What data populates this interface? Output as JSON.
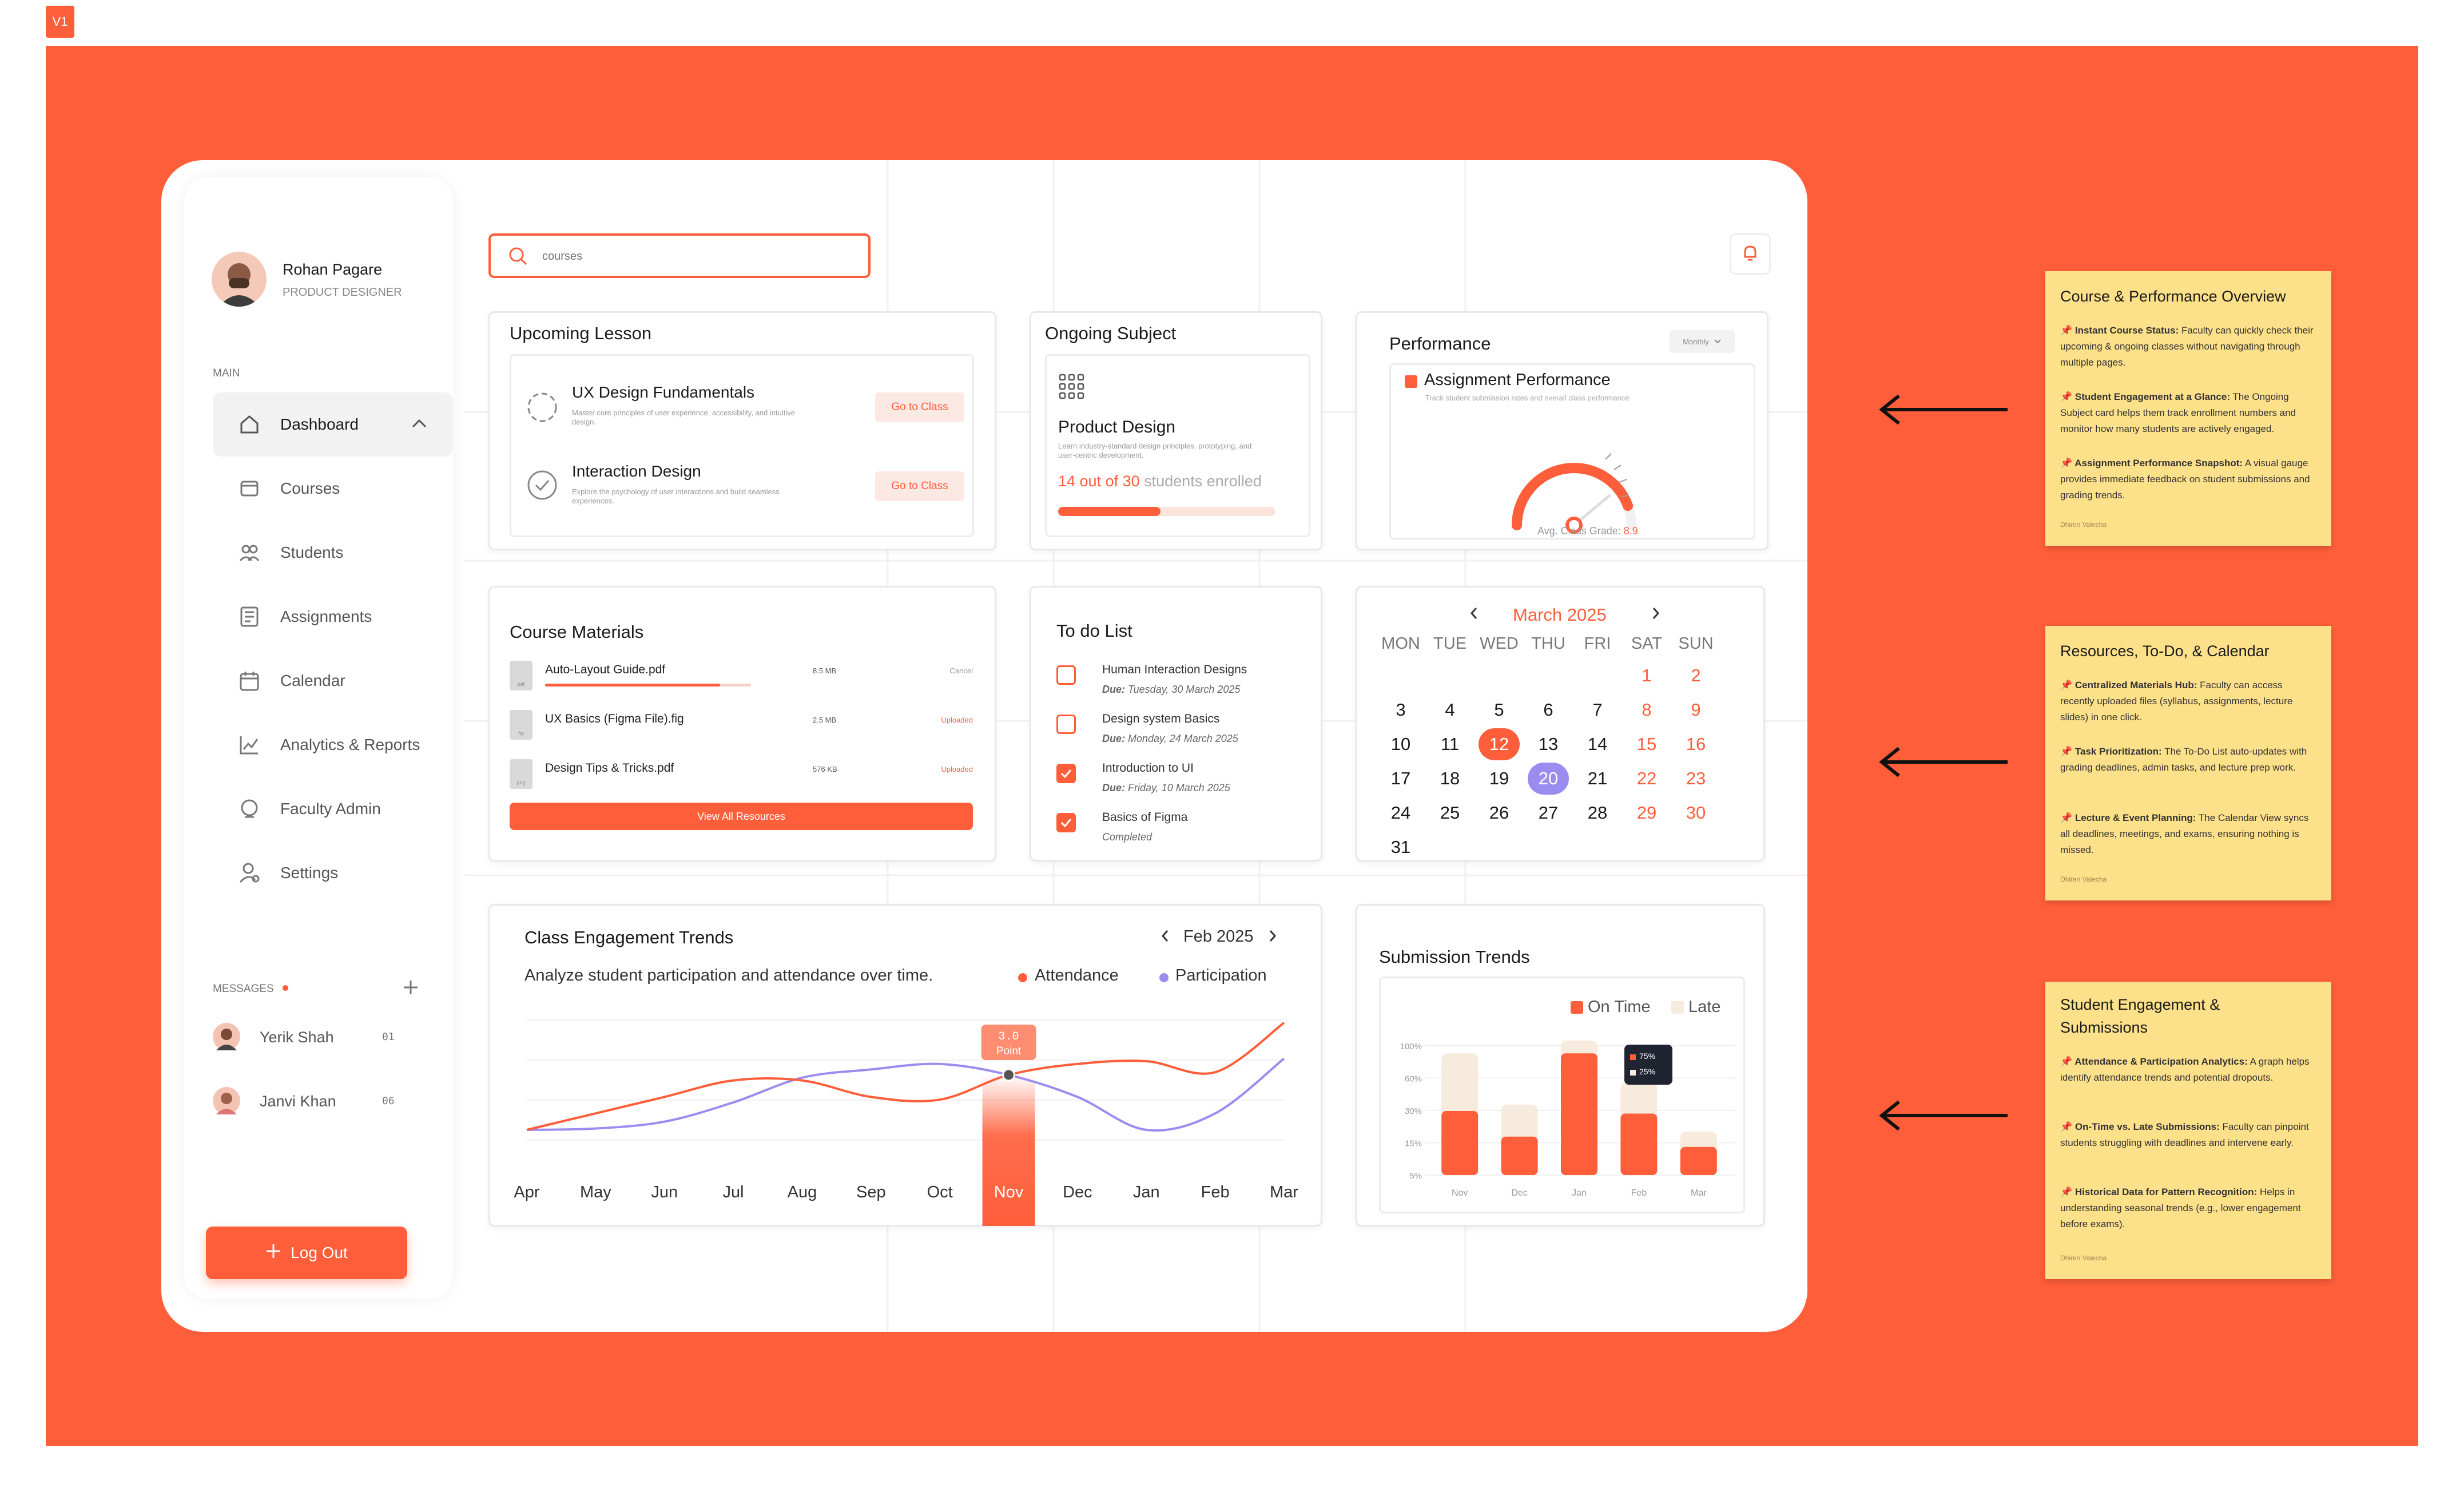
{
  "badge": "V1",
  "colors": {
    "accent": "#ff5e3a",
    "purple": "#9b8cf0",
    "note": "#fde08a",
    "late": "#f7ebdd"
  },
  "profile": {
    "name": "Rohan Pagare",
    "role": "PRODUCT DESIGNER"
  },
  "sidebar": {
    "section_main": "MAIN",
    "items": [
      {
        "label": "Dashboard",
        "icon": "dashboard-icon"
      },
      {
        "label": "Courses",
        "icon": "courses-icon"
      },
      {
        "label": "Students",
        "icon": "students-icon"
      },
      {
        "label": "Assignments",
        "icon": "assignments-icon"
      },
      {
        "label": "Calendar",
        "icon": "calendar-icon"
      },
      {
        "label": "Analytics & Reports",
        "icon": "analytics-icon"
      },
      {
        "label": "Faculty Admin",
        "icon": "faculty-icon"
      },
      {
        "label": "Settings",
        "icon": "settings-icon"
      }
    ],
    "messages_label": "MESSAGES",
    "messages": [
      {
        "name": "Yerik Shah",
        "count": "01"
      },
      {
        "name": "Janvi Khan",
        "count": "06"
      }
    ],
    "logout": "Log Out"
  },
  "search": {
    "placeholder": "courses"
  },
  "upcoming": {
    "title": "Upcoming Lesson",
    "lessons": [
      {
        "title": "UX Design Fundamentals",
        "desc": "Master core principles of user experience, accessibility, and intuitive design.",
        "button": "Go to Class"
      },
      {
        "title": "Interaction Design",
        "desc": "Explore the psychology of user interactions and build seamless experiences.",
        "button": "Go to Class"
      }
    ]
  },
  "ongoing": {
    "title": "Ongoing Subject",
    "subject": "Product Design",
    "desc": "Learn industry-standard design principles, prototyping, and user-centric development.",
    "enrolled_highlight": "14 out of 30",
    "enrolled_rest": " students enrolled",
    "progress": 0.47
  },
  "performance": {
    "title": "Performance",
    "dropdown": "Monthly",
    "subtitle": "Assignment Performance",
    "desc": "Track student submission rates and overall class performance",
    "grade_label": "Avg. Class Grade: ",
    "grade_value": "8.9",
    "gauge_fraction": 0.89
  },
  "materials": {
    "title": "Course Materials",
    "files": [
      {
        "name": "Auto-Layout Guide.pdf",
        "ext": "pdf",
        "size": "8.5 MB",
        "status": "Cancel",
        "progress": 0.85
      },
      {
        "name": "UX Basics (Figma File).fig",
        "ext": "fig",
        "size": "2.5 MB",
        "status": "Uploaded"
      },
      {
        "name": "Design Tips & Tricks.pdf",
        "ext": "png",
        "size": "576 KB",
        "status": "Uploaded"
      }
    ],
    "button": "View All Resources"
  },
  "todo": {
    "title": "To do List",
    "items": [
      {
        "title": "Human Interaction Designs",
        "due_label": "Due:",
        "due": " Tuesday, 30 March 2025",
        "done": false
      },
      {
        "title": "Design system Basics",
        "due_label": "Due:",
        "due": " Monday, 24 March 2025",
        "done": false
      },
      {
        "title": "Introduction to UI",
        "due_label": "Due:",
        "due": " Friday, 10 March 2025",
        "done": true
      },
      {
        "title": "Basics of Figma",
        "due_label": "",
        "due": "Completed",
        "done": true
      }
    ]
  },
  "calendar": {
    "month": "March 2025",
    "days": [
      "MON",
      "TUE",
      "WED",
      "THU",
      "FRI",
      "SAT",
      "SUN"
    ],
    "weeks": [
      [
        "",
        "",
        "",
        "",
        "",
        "1",
        "2"
      ],
      [
        "3",
        "4",
        "5",
        "6",
        "7",
        "8",
        "9"
      ],
      [
        "10",
        "11",
        "12",
        "13",
        "14",
        "15",
        "16"
      ],
      [
        "17",
        "18",
        "19",
        "20",
        "21",
        "22",
        "23"
      ],
      [
        "24",
        "25",
        "26",
        "27",
        "28",
        "29",
        "30"
      ],
      [
        "31",
        "",
        "",
        "",
        "",
        "",
        ""
      ]
    ],
    "today": "12",
    "selected": "20"
  },
  "engagement": {
    "title": "Class Engagement Trends",
    "period": "Feb 2025",
    "subtitle": "Analyze student participation and attendance over time.",
    "legend_attendance": "Attendance",
    "legend_participation": "Participation",
    "tooltip_value": "3.0",
    "tooltip_label": "Point",
    "highlight": "Nov"
  },
  "submission": {
    "title": "Submission Trends",
    "legend_ontime": "On Time",
    "legend_late": "Late",
    "tooltip_ontime": "75%",
    "tooltip_late": "25%"
  },
  "chart_data": [
    {
      "type": "line",
      "title": "Class Engagement Trends",
      "categories": [
        "Apr",
        "May",
        "Jun",
        "Jul",
        "Aug",
        "Sep",
        "Oct",
        "Nov",
        "Dec",
        "Jan",
        "Feb",
        "Mar"
      ],
      "series": [
        {
          "name": "Attendance",
          "values": [
            1.0,
            1.6,
            2.2,
            2.8,
            2.8,
            2.2,
            2.1,
            3.0,
            3.4,
            3.5,
            3.1,
            4.9
          ]
        },
        {
          "name": "Participation",
          "values": [
            1.0,
            1.05,
            1.3,
            2.0,
            2.9,
            3.2,
            3.4,
            3.0,
            2.2,
            1.0,
            1.6,
            3.6
          ]
        }
      ],
      "ylim": [
        0,
        5
      ]
    },
    {
      "type": "bar",
      "title": "Submission Trends",
      "categories": [
        "Nov",
        "Dec",
        "Jan",
        "Feb",
        "Mar"
      ],
      "ytick_labels": [
        "100%",
        "60%",
        "30%",
        "15%",
        "5%"
      ],
      "series": [
        {
          "name": "On Time",
          "values": [
            50,
            30,
            95,
            48,
            22
          ]
        },
        {
          "name": "Late",
          "values": [
            45,
            25,
            10,
            24,
            12
          ]
        }
      ],
      "ylim": [
        0,
        100
      ]
    }
  ],
  "notes": [
    {
      "title": "Course & Performance Overview",
      "points": [
        {
          "head": "📌 Instant Course Status:",
          "body": " Faculty can quickly check their upcoming & ongoing classes without navigating through multiple pages."
        },
        {
          "head": "📌 Student Engagement at a Glance:",
          "body": " The Ongoing Subject card helps them track enrollment numbers and monitor how many students are actively engaged."
        },
        {
          "head": "📌 Assignment Performance Snapshot:",
          "body": " A visual gauge provides immediate feedback on student submissions and grading trends."
        }
      ],
      "sign": "Dhiren Valecha"
    },
    {
      "title": "Resources, To-Do, & Calendar",
      "points": [
        {
          "head": "📌 Centralized Materials Hub:",
          "body": " Faculty can access recently uploaded files (syllabus, assignments, lecture slides) in one click."
        },
        {
          "head": "📌 Task Prioritization:",
          "body": " The To-Do List auto-updates with grading deadlines, admin tasks, and lecture prep work."
        },
        {
          "head": "📌 Lecture & Event Planning:",
          "body": " The Calendar View syncs all deadlines, meetings, and exams, ensuring nothing is missed."
        }
      ],
      "sign": "Dhiren Valecha"
    },
    {
      "title": "Student Engagement & Submissions",
      "points": [
        {
          "head": "📌 Attendance & Participation Analytics:",
          "body": " A graph helps identify attendance trends and potential dropouts."
        },
        {
          "head": "📌 On-Time vs. Late Submissions:",
          "body": " Faculty can pinpoint students struggling with deadlines and intervene early."
        },
        {
          "head": "📌 Historical Data for Pattern Recognition:",
          "body": " Helps in understanding seasonal trends (e.g., lower engagement before exams)."
        }
      ],
      "sign": "Dhiren Valecha"
    }
  ]
}
